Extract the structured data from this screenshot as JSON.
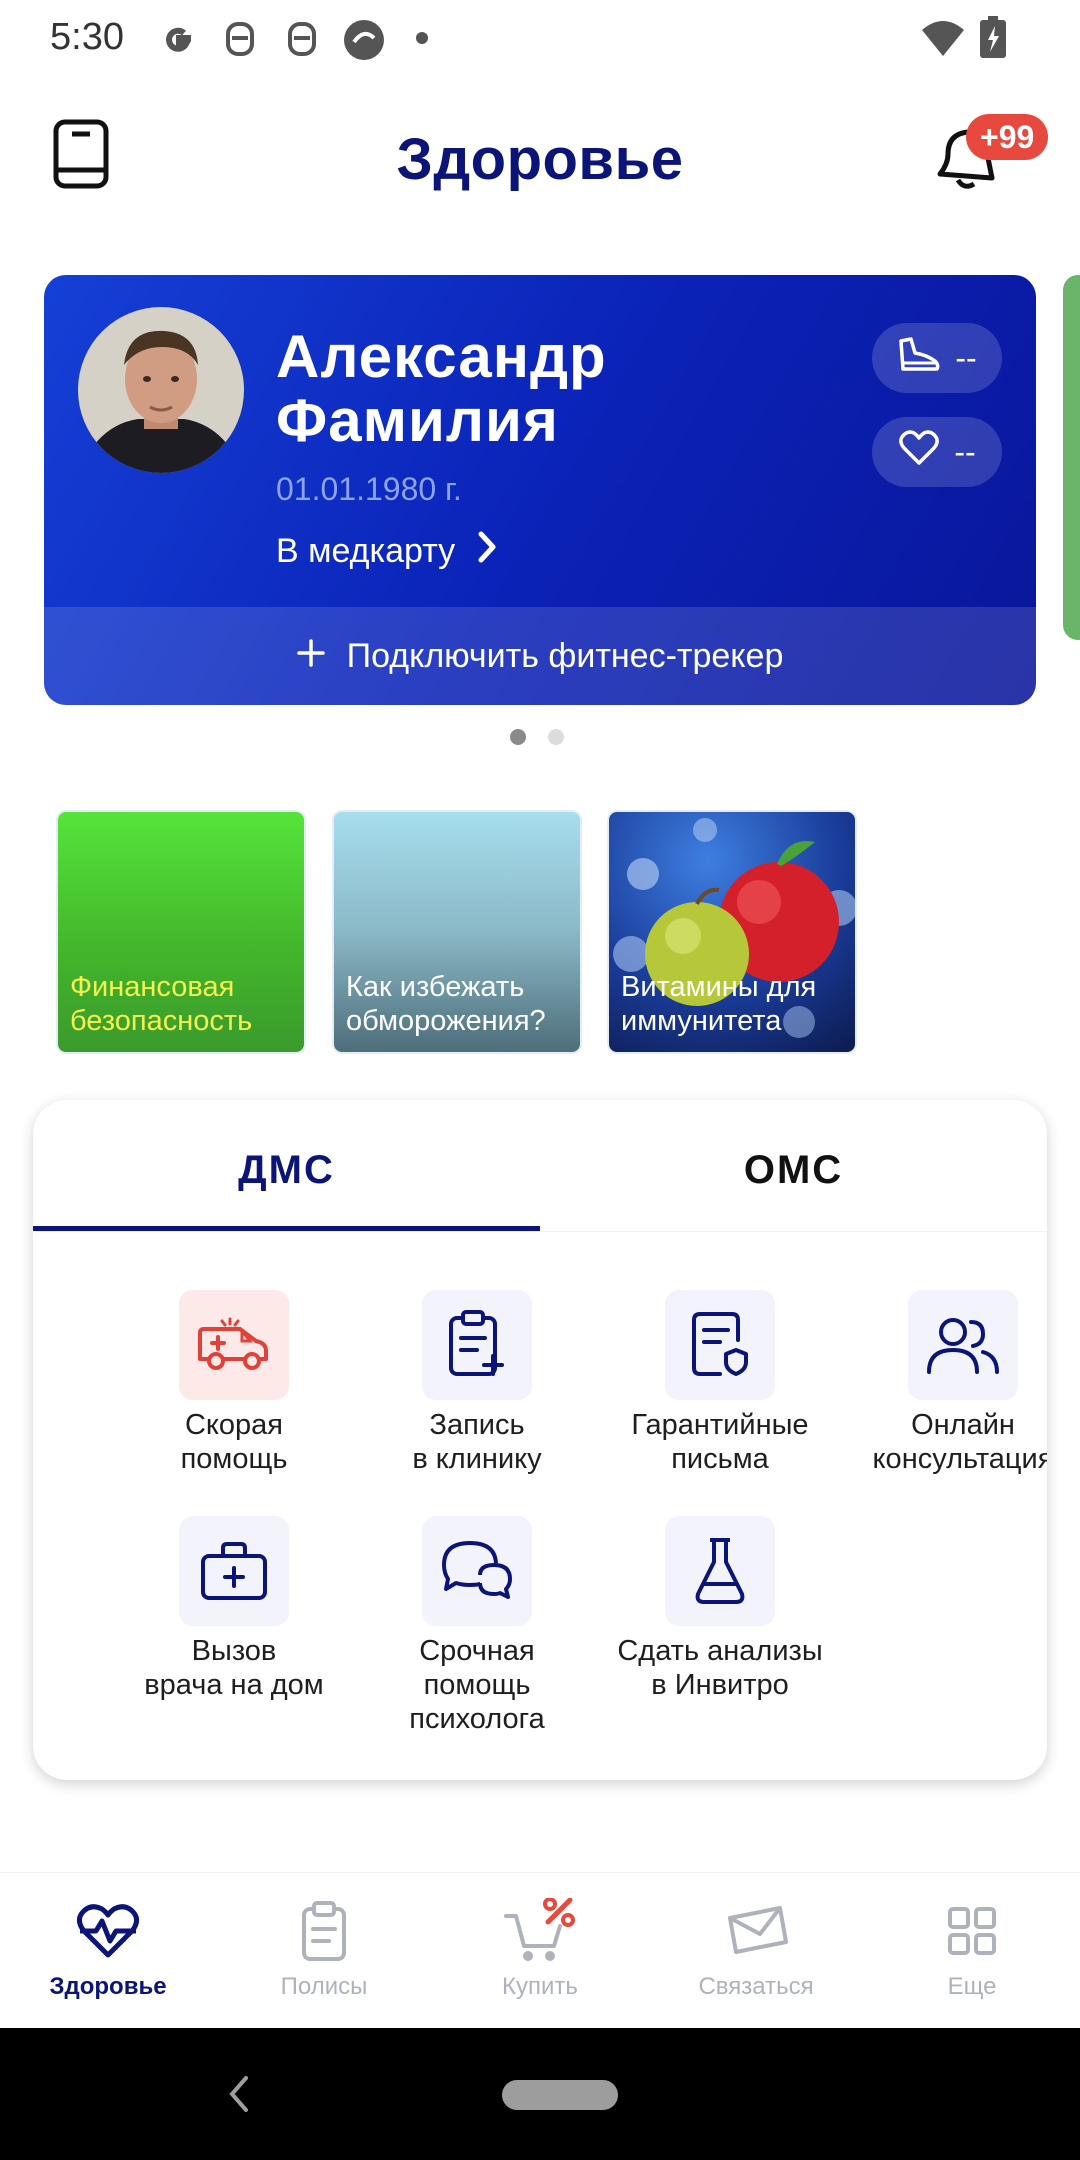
{
  "status_bar": {
    "time": "5:30",
    "icons": [
      "google-icon",
      "notification-bot-icon",
      "notification-bot-icon",
      "sync-app-icon",
      "dot-icon",
      "wifi-icon",
      "battery-charging-icon"
    ]
  },
  "header": {
    "title": "Здоровье",
    "notification_badge": "+99",
    "left_icon": "book-icon",
    "right_icon": "bell-icon"
  },
  "profile_card": {
    "name_line1": "Александр",
    "name_line2": "Фамилия",
    "dob": "01.01.1980 г.",
    "medcard_link": "В медкарту",
    "steps_value": "--",
    "heart_value": "--",
    "fitness_tracker_button": "Подключить фитнес-трекер",
    "colors": {
      "gradient_start": "#1540d6",
      "gradient_end": "#0a169a"
    }
  },
  "carousel": {
    "pages": 2,
    "active": 0
  },
  "stories": [
    {
      "label_line1": "Финансовая",
      "label_line2": "безопасность"
    },
    {
      "label_line1": "Как избежать",
      "label_line2": "обморожения?"
    },
    {
      "label_line1": "Витамины для",
      "label_line2": "иммунитета"
    }
  ],
  "services_panel": {
    "tabs": [
      {
        "label": "ДМС",
        "active": true
      },
      {
        "label": "ОМС",
        "active": false
      }
    ],
    "items": [
      {
        "line1": "Скорая",
        "line2": "помощь",
        "icon": "ambulance-icon"
      },
      {
        "line1": "Запись",
        "line2": "в клинику",
        "icon": "clipboard-plus-icon"
      },
      {
        "line1": "Гарантийные",
        "line2": "письма",
        "icon": "document-shield-icon"
      },
      {
        "line1": "Онлайн",
        "line2": "консультация",
        "icon": "users-icon"
      },
      {
        "line1": "Вызов",
        "line2": "врача на дом",
        "icon": "medical-bag-icon"
      },
      {
        "line1": "Срочная",
        "line2": "помощь",
        "line3": "психолога",
        "icon": "chat-bubbles-icon"
      },
      {
        "line1": "Сдать анализы",
        "line2": "в Инвитро",
        "icon": "flask-icon"
      }
    ]
  },
  "bottom_nav": {
    "items": [
      {
        "label": "Здоровье",
        "icon": "heart-pulse-icon",
        "active": true
      },
      {
        "label": "Полисы",
        "icon": "clipboard-icon",
        "active": false
      },
      {
        "label": "Купить",
        "icon": "cart-percent-icon",
        "active": false
      },
      {
        "label": "Связаться",
        "icon": "envelope-icon",
        "active": false
      },
      {
        "label": "Еще",
        "icon": "grid-icon",
        "active": false
      }
    ]
  },
  "accent_color": "#0b1577",
  "alert_color": "#e8493e"
}
